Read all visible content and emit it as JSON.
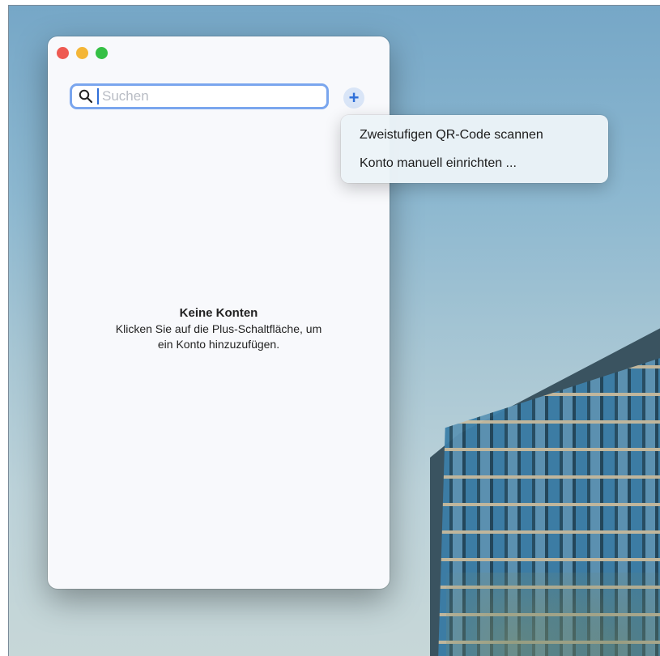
{
  "window": {
    "controls": [
      "close",
      "minimize",
      "zoom"
    ]
  },
  "search": {
    "placeholder": "Suchen",
    "value": "",
    "icon": "search-icon"
  },
  "toolbar": {
    "add_label": "+"
  },
  "empty_state": {
    "title": "Keine Konten",
    "line1": "Klicken Sie auf die Plus-Schaltfläche, um",
    "line2": "ein Konto hinzuzufügen."
  },
  "menu": {
    "items": [
      {
        "label": "Zweistufigen QR-Code scannen"
      },
      {
        "label": "Konto manuell einrichten ..."
      }
    ]
  },
  "colors": {
    "accent": "#2f6fd8",
    "focus_ring": "#7aa6ee",
    "close": "#ee5a52",
    "minimize": "#f4b637",
    "zoom": "#35c045"
  }
}
